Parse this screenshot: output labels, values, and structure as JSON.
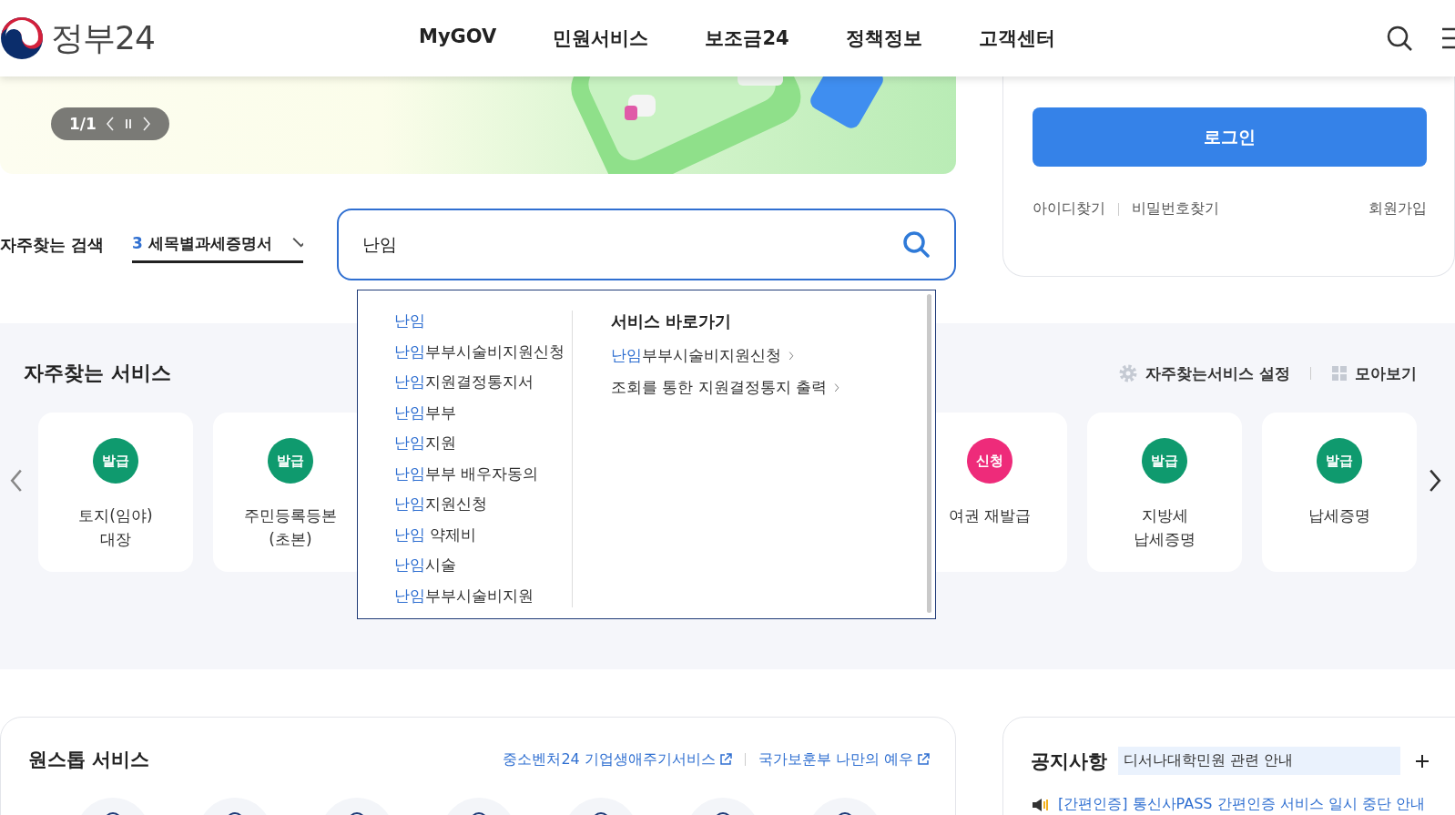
{
  "header": {
    "logo_text": "정부24",
    "nav": [
      "MyGOV",
      "민원서비스",
      "보조금24",
      "정책정보",
      "고객센터"
    ]
  },
  "banner": {
    "kind": "picture",
    "pager": "1/1"
  },
  "login": {
    "button": "로그인",
    "links": [
      "아이디찾기",
      "비밀번호찾기"
    ],
    "signup": "회원가입"
  },
  "frequent_search": {
    "label": "자주찾는 검색",
    "rank": "3",
    "term": "세목별과세증명서"
  },
  "search": {
    "value": "난임"
  },
  "suggestions": {
    "items": [
      {
        "match": "난임"
      },
      {
        "match": "난임",
        "rest": "부부시술비지원신청"
      },
      {
        "match": "난임",
        "rest": "지원결정통지서"
      },
      {
        "match": "난임",
        "rest": "부부"
      },
      {
        "match": "난임",
        "rest": "지원"
      },
      {
        "match": "난임",
        "rest": "부부 배우자동의"
      },
      {
        "match": "난임",
        "rest": "지원신청"
      },
      {
        "match": "난임",
        "rest": " 약제비"
      },
      {
        "match": "난임",
        "rest": "시술"
      },
      {
        "match": "난임",
        "rest": "부부시술비지원"
      }
    ],
    "shortcut_title": "서비스 바로가기",
    "shortcuts": [
      {
        "match": "난임",
        "rest": "부부시술비지원신청"
      },
      {
        "rest": "조회를 통한 지원결정통지 출력"
      }
    ]
  },
  "frequent_services": {
    "title": "자주찾는 서비스",
    "settings": "자주찾는서비스 설정",
    "view_all": "모아보기",
    "cards": [
      {
        "badge": "발급",
        "color": "#0f9a6e",
        "label": [
          "토지(임야)",
          "대장"
        ]
      },
      {
        "badge": "발급",
        "color": "#0f9a6e",
        "label": [
          "주민등록등본",
          "(초본)"
        ]
      },
      {
        "badge": "신청",
        "color": "#ee2b7a",
        "label": [
          "여권 재발급"
        ]
      },
      {
        "badge": "발급",
        "color": "#0f9a6e",
        "label": [
          "지방세",
          "납세증명"
        ]
      },
      {
        "badge": "발급",
        "color": "#0f9a6e",
        "label": [
          "납세증명"
        ]
      }
    ]
  },
  "onestop": {
    "title": "원스톱 서비스",
    "links": [
      "중소벤처24 기업생애주기서비스",
      "국가보훈부 나만의 예우"
    ]
  },
  "notice": {
    "title": "공지사항",
    "ticker": "디서나대학민원 관련 안내",
    "item": "[간편인증] 통신사PASS 간편인증 서비스 일시 중단 안내"
  }
}
